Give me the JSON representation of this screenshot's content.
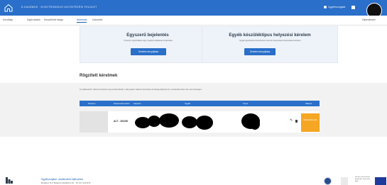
{
  "topbar": {
    "brand": "E-KAZÁNOK · ELEKTRONIKUS ÜGYINTÉZÉSI FELÜLET",
    "language": "Ügyfélszolgálat",
    "colors": {
      "primary": "#2a6fc9",
      "accent": "#f5a623"
    }
  },
  "nav": {
    "items": [
      {
        "label": "Kezdőlap"
      },
      {
        "label": "Saját adatok"
      },
      {
        "label": "Készülékek listája"
      },
      {
        "label": "Kérelmek"
      },
      {
        "label": "Üzenetek"
      }
    ],
    "right": "Kijelentkezés"
  },
  "cards": [
    {
      "title": "Egyszerű bejelentés",
      "description": "Új kazán regisztrálása vagy meglévő adatainak módosítása.",
      "button": "Kérelem benyújtása"
    },
    {
      "title": "Egyéb készüléktípus helyezési kérelem",
      "description": "Egyéb gáztüzelésű berendezés üzembe helyezésével kapcsolatos kérelem.",
      "button": "Kérelem benyújtása"
    }
  ],
  "section": {
    "title": "Rögzített kérelmek"
  },
  "info": "Az „Előkészítés” státuszú kérelmek még szerkeszthetők. A „Benyújtva” státuszú kérelmeket a hatóság dolgozza fel, a módosítás ekkor már nem lehetséges.",
  "table": {
    "headers": [
      "Kérelem",
      "Kérelemazonosító",
      "Helyszín",
      "Ügyfél",
      "Típus",
      "Státusz"
    ],
    "rows": [
      {
        "code": "ALT - 2024/8",
        "status": "Előkészítés alatt"
      }
    ]
  },
  "footer": {
    "links": "Ügyfélszolgálat · Adatkezelési tájékoztató",
    "address": "Budapest, 1117 Budapest, Budafoki út 59. · Tel: 06 1 234 5678",
    "eu_text": "Európai Unió Európai Regionális Fejlesztési Alap"
  }
}
